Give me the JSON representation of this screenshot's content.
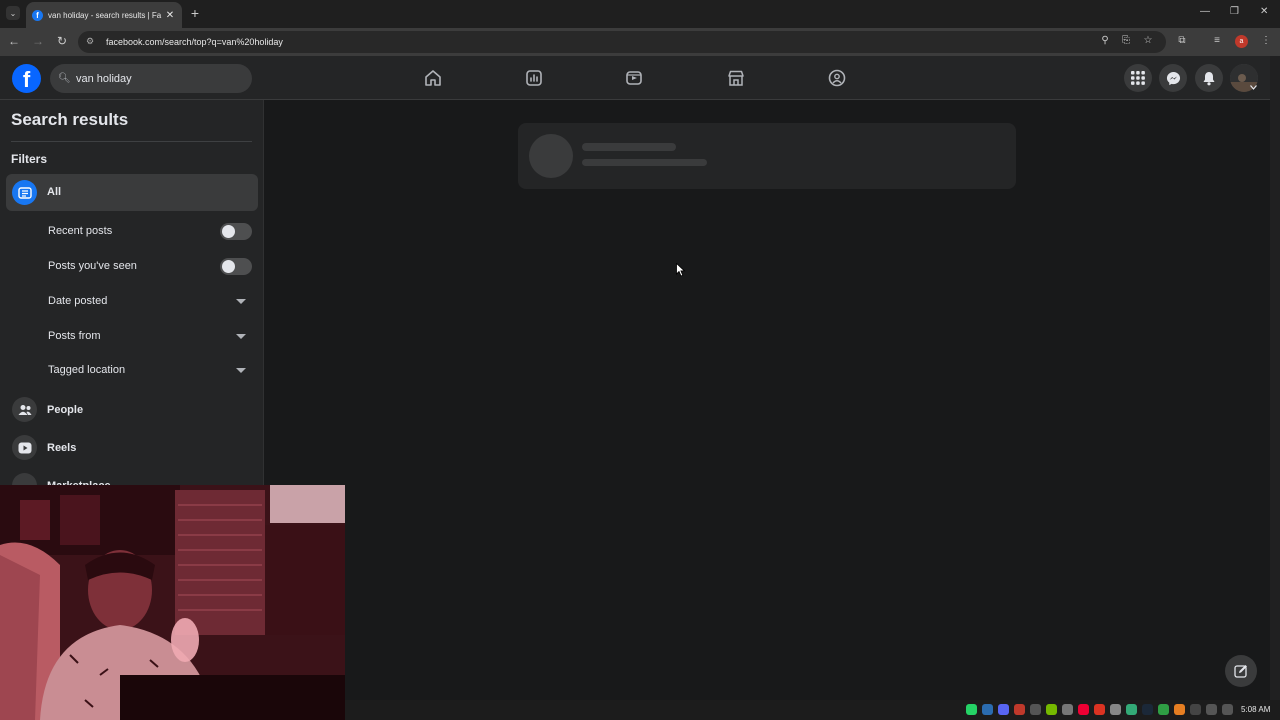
{
  "browser": {
    "tab_title": "van holiday - search results | Fa",
    "tab_close": "✕",
    "new_tab": "+",
    "url": "facebook.com/search/top?q=van%20holiday",
    "profile_initial": "a"
  },
  "header": {
    "search_value": "van holiday"
  },
  "sidebar": {
    "title": "Search results",
    "filters_label": "Filters",
    "all_label": "All",
    "options": [
      {
        "label": "Recent posts",
        "type": "toggle",
        "on": false
      },
      {
        "label": "Posts you've seen",
        "type": "toggle",
        "on": false
      },
      {
        "label": "Date posted",
        "type": "dropdown"
      },
      {
        "label": "Posts from",
        "type": "dropdown"
      },
      {
        "label": "Tagged location",
        "type": "dropdown"
      }
    ],
    "categories": [
      {
        "label": "People",
        "icon": "people-icon"
      },
      {
        "label": "Reels",
        "icon": "reels-icon"
      },
      {
        "label": "Marketplace",
        "icon": "marketplace-icon"
      }
    ]
  },
  "taskbar": {
    "time": "5:08 AM"
  },
  "colors": {
    "accent": "#1877f2",
    "surface": "#242526",
    "background": "#18191a"
  }
}
